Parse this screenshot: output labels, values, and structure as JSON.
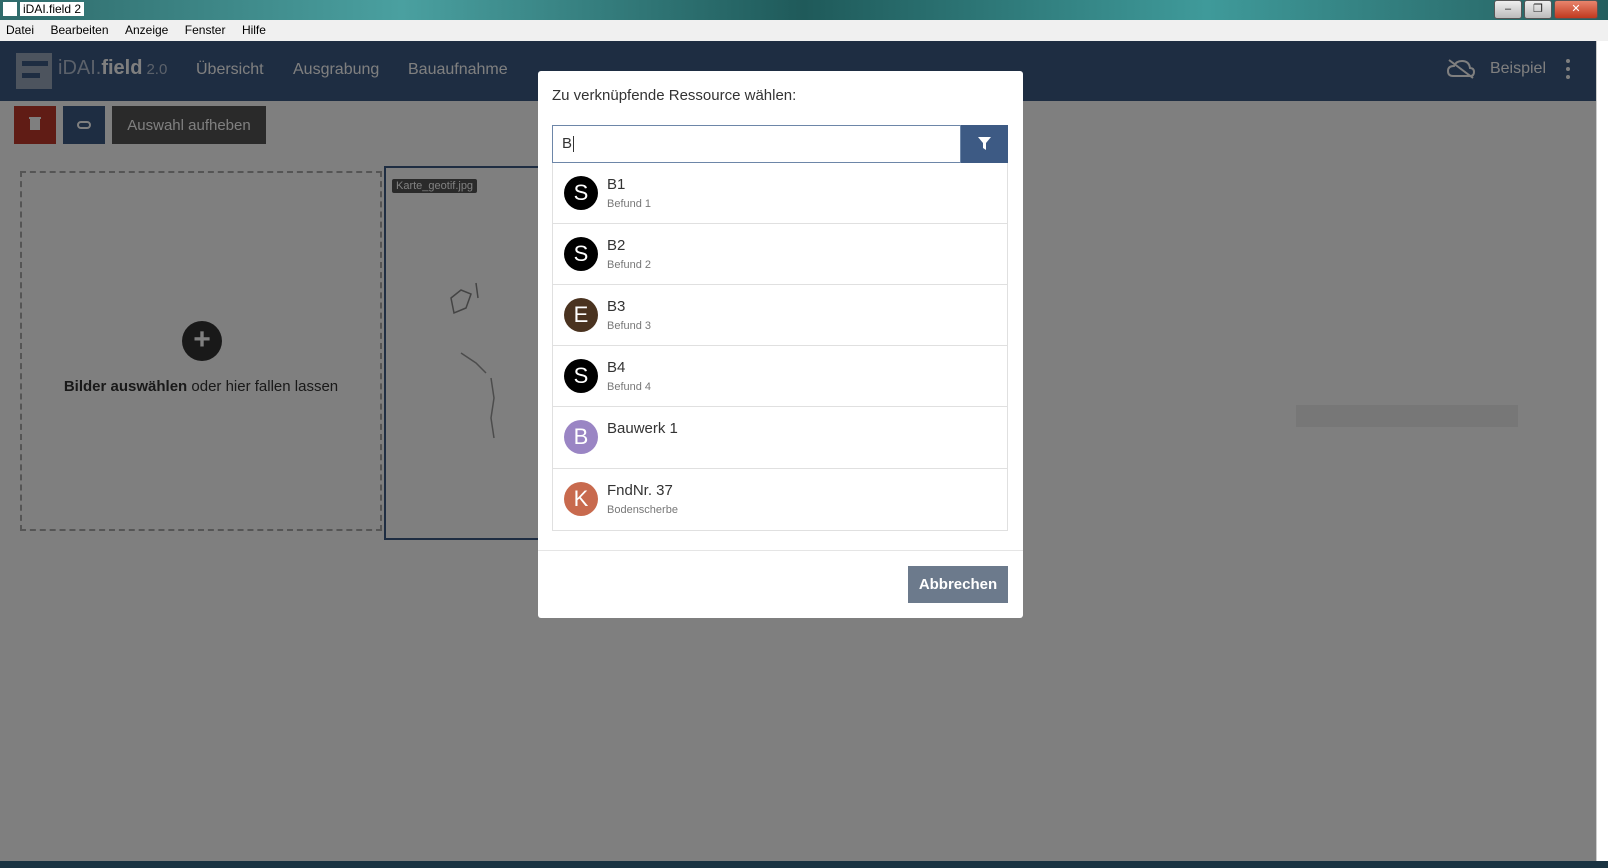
{
  "window": {
    "title": "iDAI.field 2"
  },
  "menu": [
    "Datei",
    "Bearbeiten",
    "Anzeige",
    "Fenster",
    "Hilfe"
  ],
  "navbar": {
    "logo_prefix": "iDAI.",
    "logo_main": "field",
    "logo_version": "2.0",
    "items": [
      "Übersicht",
      "Ausgrabung",
      "Bauaufnahme"
    ],
    "project": "Beispiel"
  },
  "toolbar": {
    "deselect_label": "Auswahl aufheben"
  },
  "dropzone": {
    "bold": "Bilder auswählen",
    "rest": " oder hier fallen lassen"
  },
  "thumbnail": {
    "label": "Karte_geotif.jpg"
  },
  "modal": {
    "title": "Zu verknüpfende Ressource wählen:",
    "search_value": "B",
    "items": [
      {
        "icon": "S",
        "color": "#000000",
        "title": "B1",
        "subtitle": "Befund 1"
      },
      {
        "icon": "S",
        "color": "#000000",
        "title": "B2",
        "subtitle": "Befund 2"
      },
      {
        "icon": "E",
        "color": "#4a3320",
        "title": "B3",
        "subtitle": "Befund 3"
      },
      {
        "icon": "S",
        "color": "#000000",
        "title": "B4",
        "subtitle": "Befund 4"
      },
      {
        "icon": "B",
        "color": "#9a85c4",
        "title": "Bauwerk 1",
        "subtitle": ""
      },
      {
        "icon": "K",
        "color": "#c86a4e",
        "title": "FndNr. 37",
        "subtitle": "Bodenscherbe"
      }
    ],
    "cancel_label": "Abbrechen"
  },
  "colors": {
    "navbar": "#3d5a84",
    "danger": "#c0392b",
    "primary": "#3d5a84"
  }
}
